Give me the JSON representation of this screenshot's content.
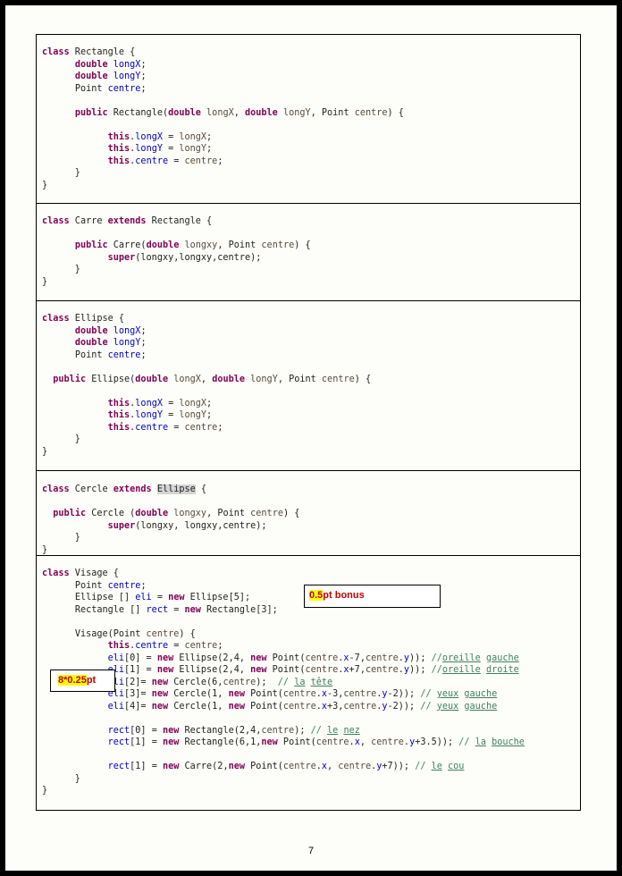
{
  "rectangle_block": {
    "l1": "class",
    "l1b": " Rectangle {",
    "f1t": "double",
    "f1n": "longX",
    "f2t": "double",
    "f2n": "longY",
    "f3t": "Point ",
    "f3n": "centre",
    "c_pub": "public",
    "c_name": " Rectangle(",
    "c_d1": "double",
    "c_p1": "longX",
    "c_d2": "double",
    "c_p2": "longY",
    "c_pt": "Point ",
    "c_p3": "centre",
    "this": "this"
  },
  "carre_block": {
    "cls": "class",
    "name": " Carre ",
    "ext": "extends",
    "parent": " Rectangle {",
    "pub": "public",
    "ctor": " Carre(",
    "d": "double",
    "p1": "longxy",
    "pt": "Point ",
    "p2": "centre",
    "sup": "super",
    "args": "(longxy,longxy,centre);"
  },
  "ellipse_block": {
    "l1": "class",
    "l1b": " Ellipse {",
    "f1t": "double",
    "f1n": "longX",
    "f2t": "double",
    "f2n": "longY",
    "f3t": "Point ",
    "f3n": "centre",
    "c_pub": "public",
    "c_name": " Ellipse(",
    "c_d1": "double",
    "c_p1": "longX",
    "c_d2": "double",
    "c_p2": "longY",
    "c_pt": "Point ",
    "c_p3": "centre",
    "this": "this"
  },
  "cercle_block": {
    "cls": "class",
    "name": " Cercle ",
    "ext": "extends",
    "parent": "Ellipse",
    "pub": "public",
    "ctor": " Cercle (",
    "d": "double",
    "p1": "longxy",
    "pt": "Point ",
    "p2": "centre",
    "sup": "super",
    "args": "(longxy, longxy,centre);"
  },
  "visage_block": {
    "cls": "class",
    "name": " Visage {",
    "f1": "Point ",
    "f1n": "centre",
    "f2": "Ellipse [] ",
    "f2n": "eli",
    "new": "new",
    "f2e": " Ellipse[5];",
    "f3": "Rectangle [] ",
    "f3n": "rect",
    "f3e": " Rectangle[3];",
    "ctor": "Visage(Point ",
    "ctorp": "centre",
    "this": "this",
    "c1": "oreille",
    "c1b": "gauche",
    "c2": "oreille",
    "c2b": "droite",
    "c3": "la",
    "c3b": "tête",
    "c4": "yeux",
    "c4b": "gauche",
    "c5": "yeux",
    "c5b": "gauche",
    "c6": "le",
    "c6b": "nez",
    "c7": "la",
    "c7b": "bouche",
    "c8": "le",
    "c8b": "cou"
  },
  "notes": {
    "bonus_hl": "0.5",
    "bonus_rest": "pt  bonus",
    "eli_hl": "8*0.25",
    "eli_rest": "pt"
  },
  "footer": {
    "page_number": "7"
  }
}
